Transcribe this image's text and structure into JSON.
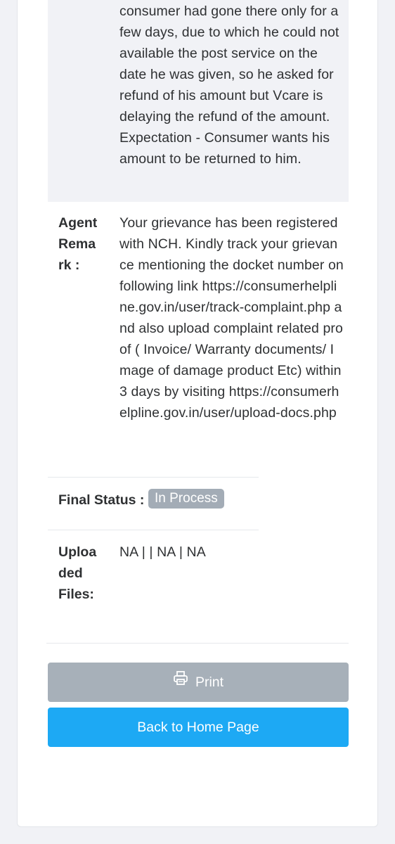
{
  "complaint": {
    "description_tail": "consumer had gone there only for a few days, due to which he could not available the post service on the date he was given, so he asked for refund of his amount but Vcare is delaying the refund of the amount. Expectation - Consumer wants his amount to be returned to him.",
    "agent_remark_label": "Agent Rema rk :",
    "agent_remark": "Your grievance has been registered with NCH. Kindly track your grievance mentioning the docket number on following link https://consumerhelpline.gov.in/user/track-complaint.php and also upload complaint related proof ( Invoice/ Warranty documents/ Image of damage product Etc) within 3 days by visiting https://consumerhelpline.gov.in/user/upload-docs.php",
    "final_status_label": "Final Status :",
    "final_status": "In Process",
    "uploaded_files_label": "Uploa ded Files:",
    "uploaded_files": "NA | | NA | NA"
  },
  "actions": {
    "print_label": "Print",
    "home_label": "Back to Home Page"
  },
  "colors": {
    "status_badge": "#a3acb6",
    "print_button": "#a7b0b9",
    "home_button": "#1da9f4"
  },
  "icons": {
    "print": "printer-icon"
  }
}
